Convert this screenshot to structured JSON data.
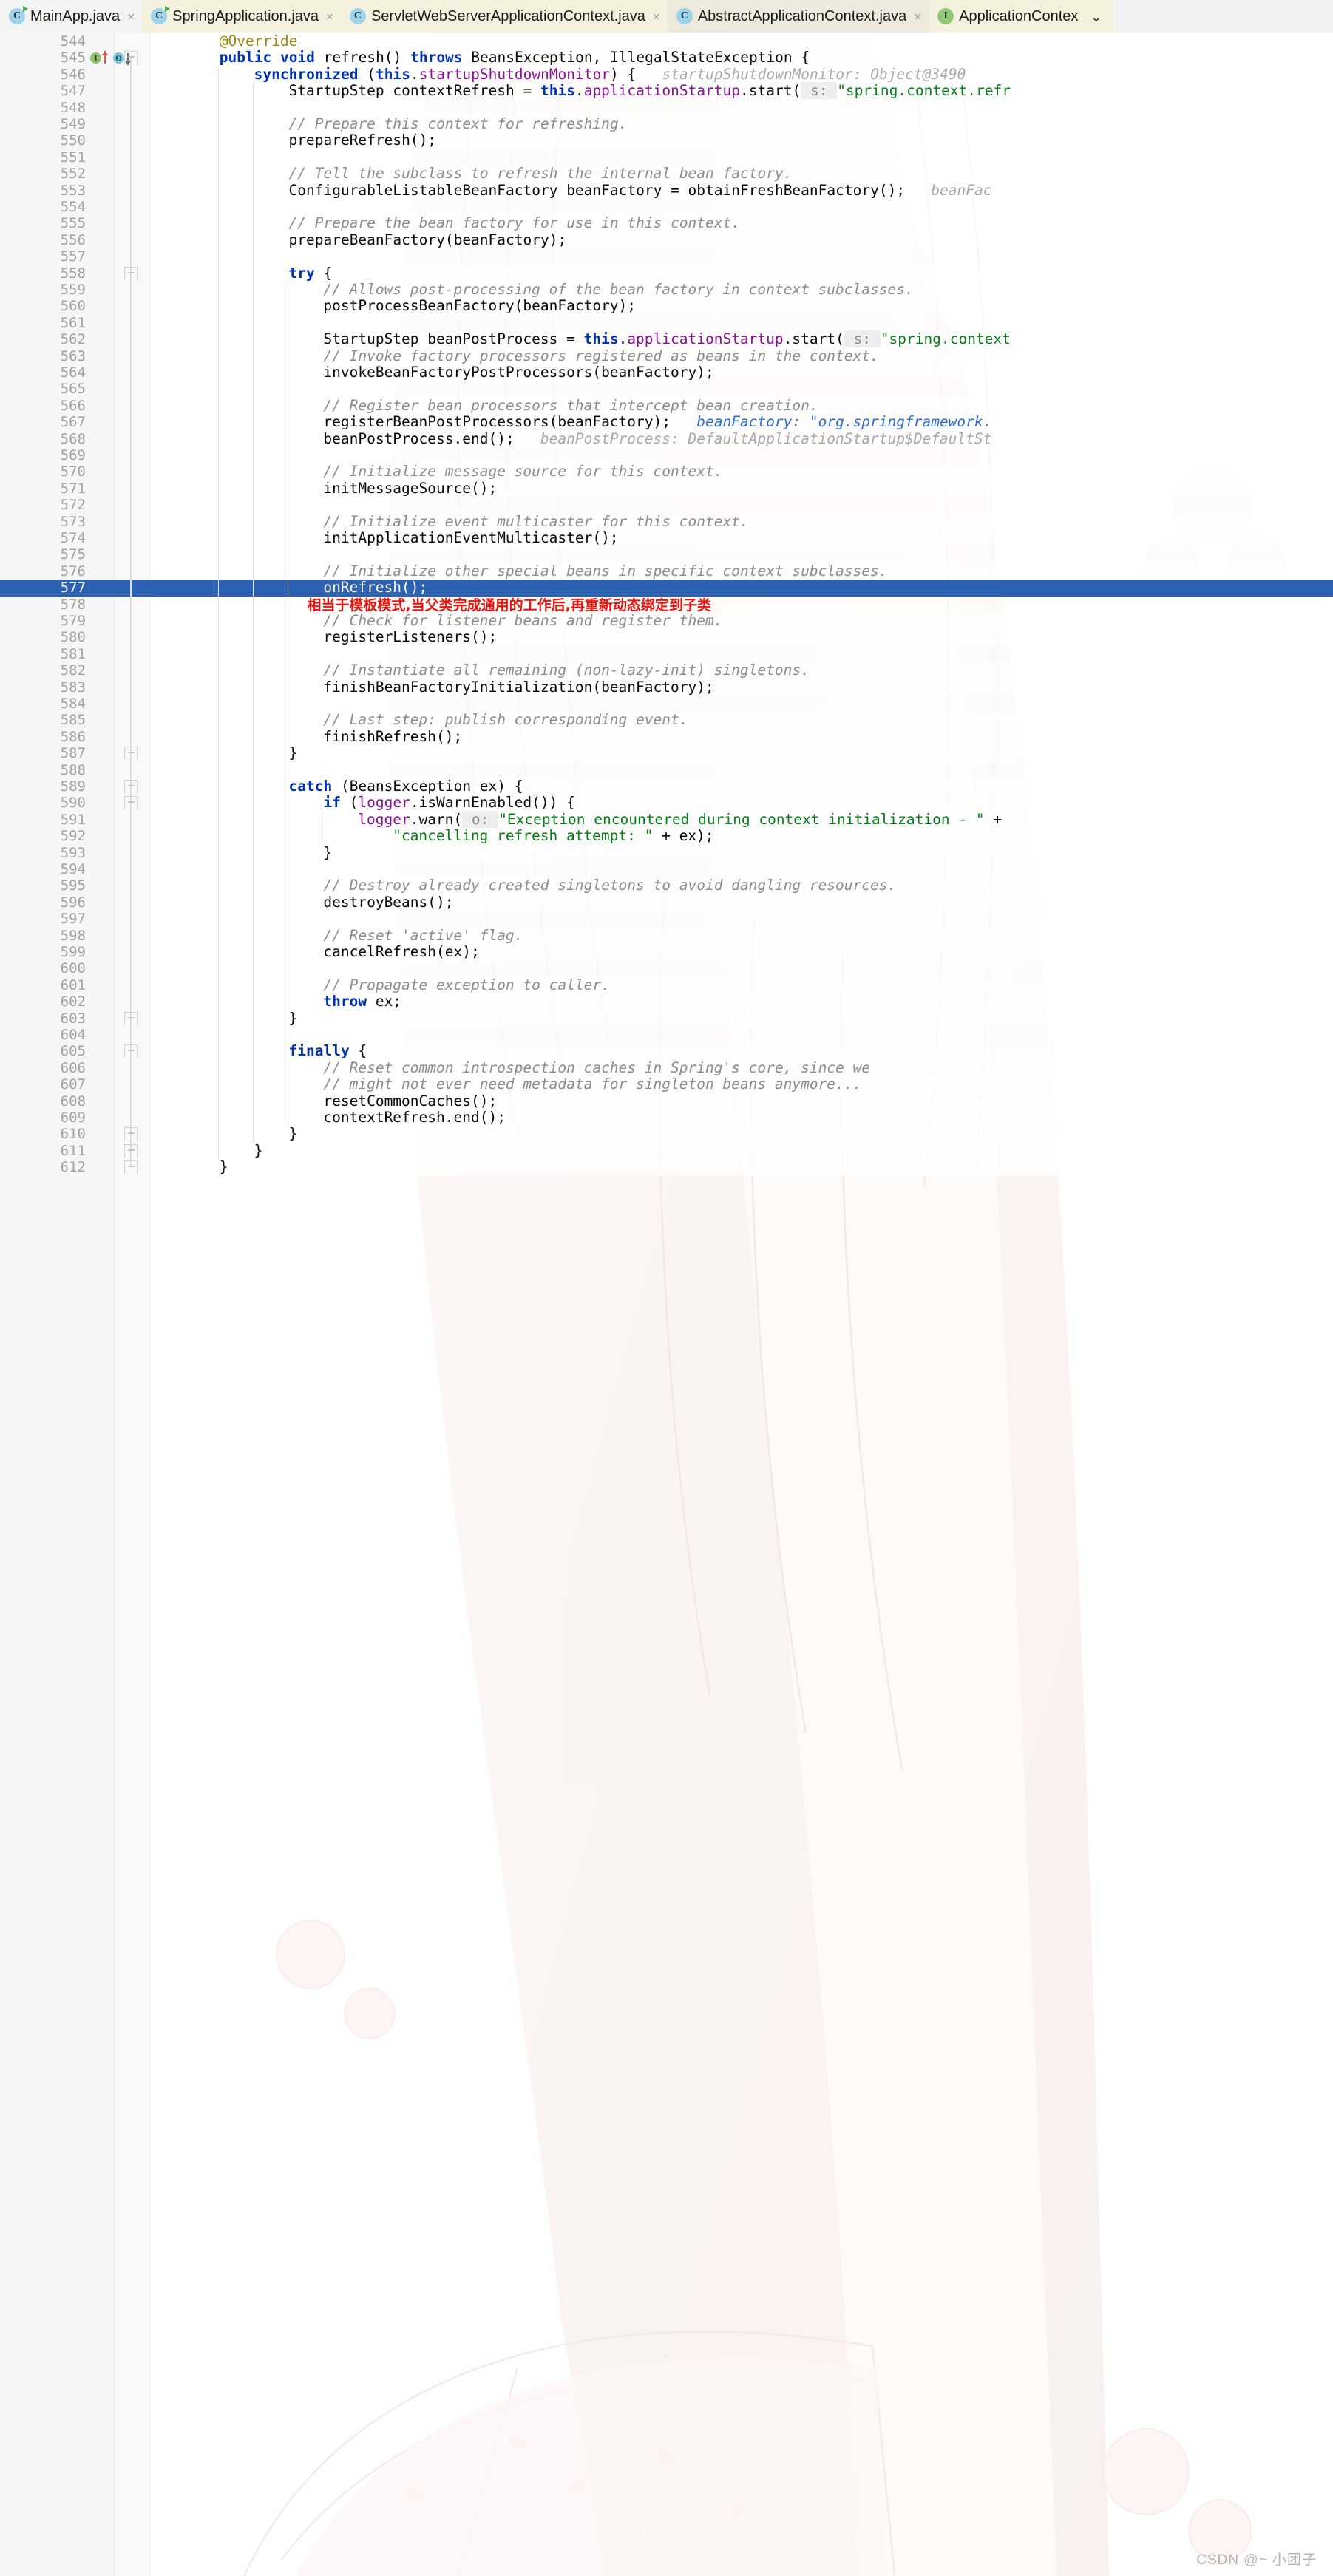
{
  "window": {
    "app": "IntelliJ IDEA Editor",
    "watermark": "CSDN @~ 小团子"
  },
  "tabs": [
    {
      "label": "MainApp.java",
      "icon": "class-run-icon",
      "close": "×",
      "state": "inactive"
    },
    {
      "label": "SpringApplication.java",
      "icon": "class-run-icon",
      "close": "×",
      "state": "inactive"
    },
    {
      "label": "ServletWebServerApplicationContext.java",
      "icon": "class-icon",
      "close": "×",
      "state": "inactive"
    },
    {
      "label": "AbstractApplicationContext.java",
      "icon": "class-icon",
      "close": "×",
      "state": "active"
    },
    {
      "label": "ApplicationContex",
      "icon": "interface-icon",
      "close": "",
      "state": "inactive"
    }
  ],
  "tab_overflow": "⌄",
  "gutter": {
    "implemented_icon": "I",
    "overridden_icon": "O",
    "implemented_tooltip": "implementing-method-marker",
    "overridden_tooltip": "overriding-method-marker"
  },
  "annotation": {
    "line": 578,
    "text": "相当于模板模式,当父类完成通用的工作后,再重新动态绑定到子类",
    "color": "#e8150f"
  },
  "selected_line": 577,
  "colors": {
    "keyword": "#0033b3",
    "string": "#067d17",
    "comment": "#8c8c8c",
    "field": "#871094",
    "annotation": "#9e880d",
    "selection": "#2d61b1",
    "gutter_bg": "#f6f6f6",
    "editor_bg": "#ffffff"
  },
  "lines": [
    {
      "n": 544,
      "indent": 2,
      "fold": false,
      "tokens": [
        {
          "t": "@Override",
          "c": "ann"
        }
      ]
    },
    {
      "n": 545,
      "indent": 2,
      "fold": true,
      "gicons": true,
      "tokens": [
        {
          "t": "public",
          "c": "kw"
        },
        {
          "t": " ",
          "c": "plain"
        },
        {
          "t": "void",
          "c": "kw"
        },
        {
          "t": " ",
          "c": "plain"
        },
        {
          "t": "refresh",
          "c": "mth"
        },
        {
          "t": "() ",
          "c": "plain"
        },
        {
          "t": "throws",
          "c": "kw"
        },
        {
          "t": " BeansException, IllegalStateException {",
          "c": "plain"
        }
      ]
    },
    {
      "n": 546,
      "indent": 3,
      "fold": false,
      "tokens": [
        {
          "t": "synchronized",
          "c": "kw"
        },
        {
          "t": " (",
          "c": "plain"
        },
        {
          "t": "this",
          "c": "thiskw"
        },
        {
          "t": ".",
          "c": "plain"
        },
        {
          "t": "startupShutdownMonitor",
          "c": "fld"
        },
        {
          "t": ") {",
          "c": "plain"
        },
        {
          "t": "   startupShutdownMonitor: Object@3490",
          "c": "hintg"
        }
      ]
    },
    {
      "n": 547,
      "indent": 4,
      "fold": false,
      "tokens": [
        {
          "t": "StartupStep contextRefresh = ",
          "c": "plain"
        },
        {
          "t": "this",
          "c": "thiskw"
        },
        {
          "t": ".",
          "c": "plain"
        },
        {
          "t": "applicationStartup",
          "c": "fld"
        },
        {
          "t": ".start(",
          "c": "plain"
        },
        {
          "t": " s: ",
          "c": "phint"
        },
        {
          "t": "\"spring.context.refr",
          "c": "str"
        }
      ]
    },
    {
      "n": 548,
      "indent": 0,
      "fold": false,
      "tokens": []
    },
    {
      "n": 549,
      "indent": 4,
      "fold": false,
      "tokens": [
        {
          "t": "// Prepare this context for refreshing.",
          "c": "cmt"
        }
      ]
    },
    {
      "n": 550,
      "indent": 4,
      "fold": false,
      "tokens": [
        {
          "t": "prepareRefresh();",
          "c": "plain"
        }
      ]
    },
    {
      "n": 551,
      "indent": 0,
      "fold": false,
      "tokens": []
    },
    {
      "n": 552,
      "indent": 4,
      "fold": false,
      "tokens": [
        {
          "t": "// Tell the subclass to refresh the internal bean factory.",
          "c": "cmt"
        }
      ]
    },
    {
      "n": 553,
      "indent": 4,
      "fold": false,
      "tokens": [
        {
          "t": "ConfigurableListableBeanFactory beanFactory = obtainFreshBeanFactory();",
          "c": "plain"
        },
        {
          "t": "   beanFac",
          "c": "hintg"
        }
      ]
    },
    {
      "n": 554,
      "indent": 0,
      "fold": false,
      "tokens": []
    },
    {
      "n": 555,
      "indent": 4,
      "fold": false,
      "tokens": [
        {
          "t": "// Prepare the bean factory for use in this context.",
          "c": "cmt"
        }
      ]
    },
    {
      "n": 556,
      "indent": 4,
      "fold": false,
      "tokens": [
        {
          "t": "prepareBeanFactory(beanFactory);",
          "c": "plain"
        }
      ]
    },
    {
      "n": 557,
      "indent": 0,
      "fold": false,
      "tokens": []
    },
    {
      "n": 558,
      "indent": 4,
      "fold": true,
      "tokens": [
        {
          "t": "try",
          "c": "kw"
        },
        {
          "t": " {",
          "c": "plain"
        }
      ]
    },
    {
      "n": 559,
      "indent": 5,
      "fold": false,
      "tokens": [
        {
          "t": "// Allows post-processing of the bean factory in context subclasses.",
          "c": "cmt"
        }
      ]
    },
    {
      "n": 560,
      "indent": 5,
      "fold": false,
      "tokens": [
        {
          "t": "postProcessBeanFactory(beanFactory);",
          "c": "plain"
        }
      ]
    },
    {
      "n": 561,
      "indent": 0,
      "fold": false,
      "tokens": []
    },
    {
      "n": 562,
      "indent": 5,
      "fold": false,
      "tokens": [
        {
          "t": "StartupStep beanPostProcess = ",
          "c": "plain"
        },
        {
          "t": "this",
          "c": "thiskw"
        },
        {
          "t": ".",
          "c": "plain"
        },
        {
          "t": "applicationStartup",
          "c": "fld"
        },
        {
          "t": ".start(",
          "c": "plain"
        },
        {
          "t": " s: ",
          "c": "phint"
        },
        {
          "t": "\"spring.context",
          "c": "str"
        }
      ]
    },
    {
      "n": 563,
      "indent": 5,
      "fold": false,
      "tokens": [
        {
          "t": "// Invoke factory processors registered as beans in the context.",
          "c": "cmt"
        }
      ]
    },
    {
      "n": 564,
      "indent": 5,
      "fold": false,
      "tokens": [
        {
          "t": "invokeBeanFactoryPostProcessors(beanFactory);",
          "c": "plain"
        }
      ]
    },
    {
      "n": 565,
      "indent": 0,
      "fold": false,
      "tokens": []
    },
    {
      "n": 566,
      "indent": 5,
      "fold": false,
      "tokens": [
        {
          "t": "// Register bean processors that intercept bean creation.",
          "c": "cmt"
        }
      ]
    },
    {
      "n": 567,
      "indent": 5,
      "fold": false,
      "tokens": [
        {
          "t": "registerBeanPostProcessors(beanFactory);",
          "c": "plain"
        },
        {
          "t": "   beanFactory: ",
          "c": "hintb"
        },
        {
          "t": "\"org.springframework.",
          "c": "hintb"
        }
      ]
    },
    {
      "n": 568,
      "indent": 5,
      "fold": false,
      "tokens": [
        {
          "t": "beanPostProcess.end();",
          "c": "plain"
        },
        {
          "t": "   beanPostProcess: DefaultApplicationStartup$DefaultSt",
          "c": "hintg"
        }
      ]
    },
    {
      "n": 569,
      "indent": 0,
      "fold": false,
      "tokens": []
    },
    {
      "n": 570,
      "indent": 5,
      "fold": false,
      "tokens": [
        {
          "t": "// Initialize message source for this context.",
          "c": "cmt"
        }
      ]
    },
    {
      "n": 571,
      "indent": 5,
      "fold": false,
      "tokens": [
        {
          "t": "initMessageSource();",
          "c": "plain"
        }
      ]
    },
    {
      "n": 572,
      "indent": 0,
      "fold": false,
      "tokens": []
    },
    {
      "n": 573,
      "indent": 5,
      "fold": false,
      "tokens": [
        {
          "t": "// Initialize event multicaster for this context.",
          "c": "cmt"
        }
      ]
    },
    {
      "n": 574,
      "indent": 5,
      "fold": false,
      "tokens": [
        {
          "t": "initApplicationEventMulticaster();",
          "c": "plain"
        }
      ]
    },
    {
      "n": 575,
      "indent": 0,
      "fold": false,
      "tokens": []
    },
    {
      "n": 576,
      "indent": 5,
      "fold": false,
      "tokens": [
        {
          "t": "// Initialize other special beans in specific context subclasses.",
          "c": "cmt"
        }
      ]
    },
    {
      "n": 577,
      "indent": 5,
      "fold": false,
      "selected": true,
      "tokens": [
        {
          "t": "onRefresh();",
          "c": "plain"
        }
      ]
    },
    {
      "n": 578,
      "indent": 5,
      "fold": false,
      "note": true,
      "tokens": []
    },
    {
      "n": 579,
      "indent": 5,
      "fold": false,
      "tokens": [
        {
          "t": "// Check for listener beans and register them.",
          "c": "cmt"
        }
      ]
    },
    {
      "n": 580,
      "indent": 5,
      "fold": false,
      "tokens": [
        {
          "t": "registerListeners();",
          "c": "plain"
        }
      ]
    },
    {
      "n": 581,
      "indent": 0,
      "fold": false,
      "tokens": []
    },
    {
      "n": 582,
      "indent": 5,
      "fold": false,
      "tokens": [
        {
          "t": "// Instantiate all remaining (non-lazy-init) singletons.",
          "c": "cmt"
        }
      ]
    },
    {
      "n": 583,
      "indent": 5,
      "fold": false,
      "tokens": [
        {
          "t": "finishBeanFactoryInitialization(beanFactory);",
          "c": "plain"
        }
      ]
    },
    {
      "n": 584,
      "indent": 0,
      "fold": false,
      "tokens": []
    },
    {
      "n": 585,
      "indent": 5,
      "fold": false,
      "tokens": [
        {
          "t": "// Last step: publish corresponding event.",
          "c": "cmt"
        }
      ]
    },
    {
      "n": 586,
      "indent": 5,
      "fold": false,
      "tokens": [
        {
          "t": "finishRefresh();",
          "c": "plain"
        }
      ]
    },
    {
      "n": 587,
      "indent": 4,
      "fold": true,
      "tokens": [
        {
          "t": "}",
          "c": "plain"
        }
      ]
    },
    {
      "n": 588,
      "indent": 0,
      "fold": false,
      "tokens": []
    },
    {
      "n": 589,
      "indent": 4,
      "fold": true,
      "tokens": [
        {
          "t": "catch",
          "c": "kw"
        },
        {
          "t": " (BeansException ex) {",
          "c": "plain"
        }
      ]
    },
    {
      "n": 590,
      "indent": 5,
      "fold": true,
      "tokens": [
        {
          "t": "if",
          "c": "kw"
        },
        {
          "t": " (",
          "c": "plain"
        },
        {
          "t": "logger",
          "c": "fld"
        },
        {
          "t": ".isWarnEnabled()) {",
          "c": "plain"
        }
      ]
    },
    {
      "n": 591,
      "indent": 6,
      "fold": false,
      "tokens": [
        {
          "t": "logger",
          "c": "fld"
        },
        {
          "t": ".warn(",
          "c": "plain"
        },
        {
          "t": " o: ",
          "c": "phint"
        },
        {
          "t": "\"Exception encountered during context initialization - \"",
          "c": "str"
        },
        {
          "t": " +",
          "c": "plain"
        }
      ]
    },
    {
      "n": 592,
      "indent": 7,
      "fold": false,
      "tokens": [
        {
          "t": "\"cancelling refresh attempt: \"",
          "c": "str"
        },
        {
          "t": " + ex);",
          "c": "plain"
        }
      ]
    },
    {
      "n": 593,
      "indent": 5,
      "fold": false,
      "tokens": [
        {
          "t": "}",
          "c": "plain"
        }
      ]
    },
    {
      "n": 594,
      "indent": 0,
      "fold": false,
      "tokens": []
    },
    {
      "n": 595,
      "indent": 5,
      "fold": false,
      "tokens": [
        {
          "t": "// Destroy already created singletons to avoid dangling resources.",
          "c": "cmt"
        }
      ]
    },
    {
      "n": 596,
      "indent": 5,
      "fold": false,
      "tokens": [
        {
          "t": "destroyBeans();",
          "c": "plain"
        }
      ]
    },
    {
      "n": 597,
      "indent": 0,
      "fold": false,
      "tokens": []
    },
    {
      "n": 598,
      "indent": 5,
      "fold": false,
      "tokens": [
        {
          "t": "// Reset 'active' flag.",
          "c": "cmt"
        }
      ]
    },
    {
      "n": 599,
      "indent": 5,
      "fold": false,
      "tokens": [
        {
          "t": "cancelRefresh(ex);",
          "c": "plain"
        }
      ]
    },
    {
      "n": 600,
      "indent": 0,
      "fold": false,
      "tokens": []
    },
    {
      "n": 601,
      "indent": 5,
      "fold": false,
      "tokens": [
        {
          "t": "// Propagate exception to caller.",
          "c": "cmt"
        }
      ]
    },
    {
      "n": 602,
      "indent": 5,
      "fold": false,
      "tokens": [
        {
          "t": "throw",
          "c": "kw"
        },
        {
          "t": " ex;",
          "c": "plain"
        }
      ]
    },
    {
      "n": 603,
      "indent": 4,
      "fold": true,
      "tokens": [
        {
          "t": "}",
          "c": "plain"
        }
      ]
    },
    {
      "n": 604,
      "indent": 0,
      "fold": false,
      "tokens": []
    },
    {
      "n": 605,
      "indent": 4,
      "fold": true,
      "tokens": [
        {
          "t": "finally",
          "c": "kw"
        },
        {
          "t": " {",
          "c": "plain"
        }
      ]
    },
    {
      "n": 606,
      "indent": 5,
      "fold": false,
      "tokens": [
        {
          "t": "// Reset common introspection caches in Spring's core, since we",
          "c": "cmt"
        }
      ]
    },
    {
      "n": 607,
      "indent": 5,
      "fold": false,
      "tokens": [
        {
          "t": "// might not ever need metadata for singleton beans anymore...",
          "c": "cmt"
        }
      ]
    },
    {
      "n": 608,
      "indent": 5,
      "fold": false,
      "tokens": [
        {
          "t": "resetCommonCaches();",
          "c": "plain"
        }
      ]
    },
    {
      "n": 609,
      "indent": 5,
      "fold": false,
      "tokens": [
        {
          "t": "contextRefresh.end();",
          "c": "plain"
        }
      ]
    },
    {
      "n": 610,
      "indent": 4,
      "fold": true,
      "tokens": [
        {
          "t": "}",
          "c": "plain"
        }
      ]
    },
    {
      "n": 611,
      "indent": 3,
      "fold": true,
      "tokens": [
        {
          "t": "}",
          "c": "plain"
        }
      ]
    },
    {
      "n": 612,
      "indent": 2,
      "fold": true,
      "tokens": [
        {
          "t": "}",
          "c": "plain"
        }
      ]
    }
  ]
}
